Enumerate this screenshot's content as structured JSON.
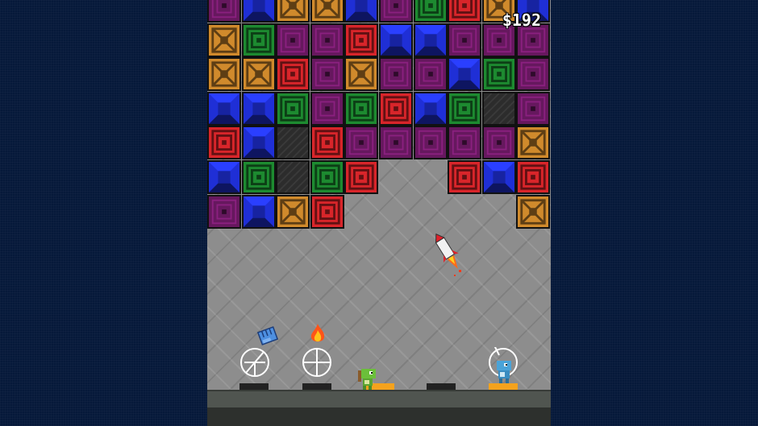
{
  "hud": {
    "money": "$192"
  },
  "colors": {
    "background": "#06193a",
    "red": "#d8252a",
    "blue": "#1f2fd6",
    "green": "#1d8a30",
    "purple": "#66185e",
    "orange": "#d08a2c",
    "stone": "#2c2c2c",
    "pad_active": "#f4a21d"
  },
  "block_grid": {
    "columns": 10,
    "rows": [
      [
        "purple",
        "blue",
        "orange",
        "orange",
        "blue",
        "purple",
        "green",
        "red",
        "orange",
        "blue"
      ],
      [
        "orange",
        "green",
        "purple",
        "purple",
        "red",
        "blue",
        "blue",
        "purple",
        "purple",
        "purple"
      ],
      [
        "orange",
        "orange",
        "red",
        "purple",
        "orange",
        "purple",
        "purple",
        "blue",
        "green",
        "purple"
      ],
      [
        "blue",
        "blue",
        "green",
        "purple",
        "green",
        "red",
        "blue",
        "green",
        "stone",
        "purple"
      ],
      [
        "red",
        "blue",
        "stone",
        "red",
        "purple",
        "purple",
        "purple",
        "purple",
        "purple",
        "orange"
      ],
      [
        "blue",
        "green",
        "stone",
        "green",
        "red",
        null,
        null,
        "red",
        "blue",
        "red"
      ],
      [
        "purple",
        "blue",
        "orange",
        "red",
        null,
        null,
        null,
        null,
        null,
        "orange"
      ]
    ]
  },
  "launchers": [
    {
      "name": "launcher-1",
      "pad_active": false,
      "weapon": "fist-icon"
    },
    {
      "name": "launcher-2",
      "pad_active": false,
      "weapon": "fire-icon"
    },
    {
      "name": "launcher-3",
      "pad_active": true,
      "weapon": ""
    },
    {
      "name": "launcher-4",
      "pad_active": false,
      "weapon": ""
    },
    {
      "name": "launcher-5",
      "pad_active": true,
      "weapon": ""
    }
  ],
  "players": [
    {
      "name": "green-dino-player",
      "color": "#6bbf3a"
    },
    {
      "name": "blue-dino-player",
      "color": "#4aa3d8"
    }
  ],
  "projectile": {
    "name": "rocket-icon"
  }
}
